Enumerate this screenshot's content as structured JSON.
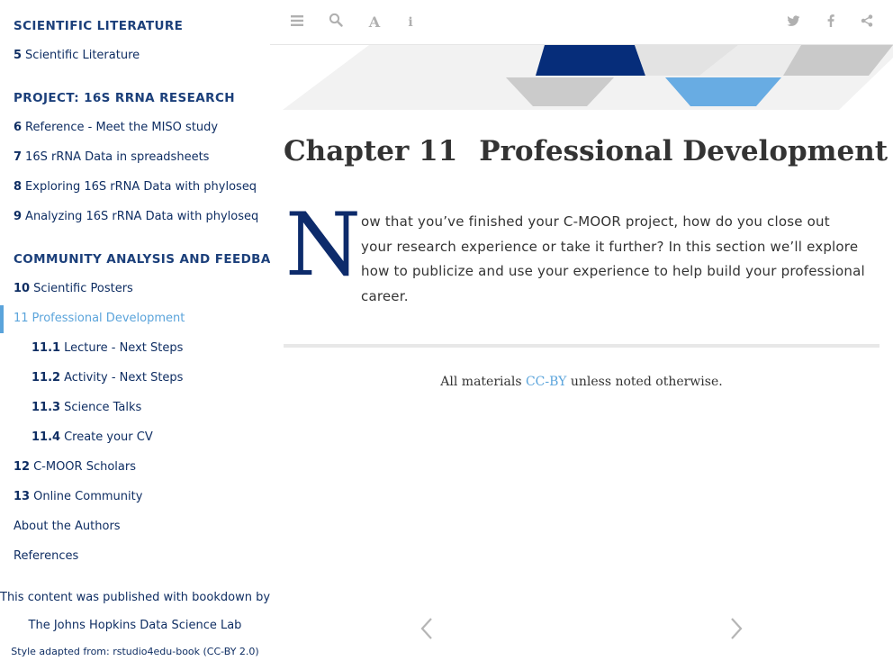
{
  "sidebar": {
    "sections": [
      {
        "label": "SCIENTIFIC LITERATURE"
      },
      {
        "label": "PROJECT: 16S RRNA RESEARCH"
      },
      {
        "label": "COMMUNITY ANALYSIS AND FEEDBACK"
      }
    ],
    "items": [
      {
        "num": "5",
        "label": "Scientific Literature"
      },
      {
        "num": "6",
        "label": "Reference - Meet the MISO study"
      },
      {
        "num": "7",
        "label": "16S rRNA Data in spreadsheets"
      },
      {
        "num": "8",
        "label": "Exploring 16S rRNA Data with phyloseq"
      },
      {
        "num": "9",
        "label": "Analyzing 16S rRNA Data with phyloseq"
      },
      {
        "num": "10",
        "label": "Scientific Posters"
      },
      {
        "num": "11",
        "label": "Professional Development"
      },
      {
        "num": "11.1",
        "label": "Lecture - Next Steps"
      },
      {
        "num": "11.2",
        "label": "Activity - Next Steps"
      },
      {
        "num": "11.3",
        "label": "Science Talks"
      },
      {
        "num": "11.4",
        "label": "Create your CV"
      },
      {
        "num": "12",
        "label": "C-MOOR Scholars"
      },
      {
        "num": "13",
        "label": "Online Community"
      },
      {
        "num": "",
        "label": "About the Authors"
      },
      {
        "num": "",
        "label": "References"
      }
    ],
    "published_by": "This content was published with bookdown by:",
    "publisher": "The Johns Hopkins Data Science Lab",
    "style_note": "Style adapted from: rstudio4edu-book (CC-BY 2.0)"
  },
  "toolbar": {
    "icons": [
      "menu-icon",
      "search-icon",
      "font-icon",
      "info-icon",
      "twitter-icon",
      "facebook-icon",
      "share-icon"
    ]
  },
  "chapter": {
    "number": "Chapter 11",
    "title": "Professional Development",
    "dropcap": "N",
    "intro": "ow that you’ve finished your C-MOOR project, how do you close out your research experience or take it further? In this section we’ll explore how to publicize and use your experience to help build your professional career."
  },
  "footer": {
    "license_prefix": "All materials",
    "license_link": "CC-BY",
    "license_suffix": "unless noted otherwise."
  },
  "colors": {
    "navy": "#0d2b6b",
    "accent_blue": "#5ba4db",
    "sidebar_text": "#0f2e63"
  }
}
